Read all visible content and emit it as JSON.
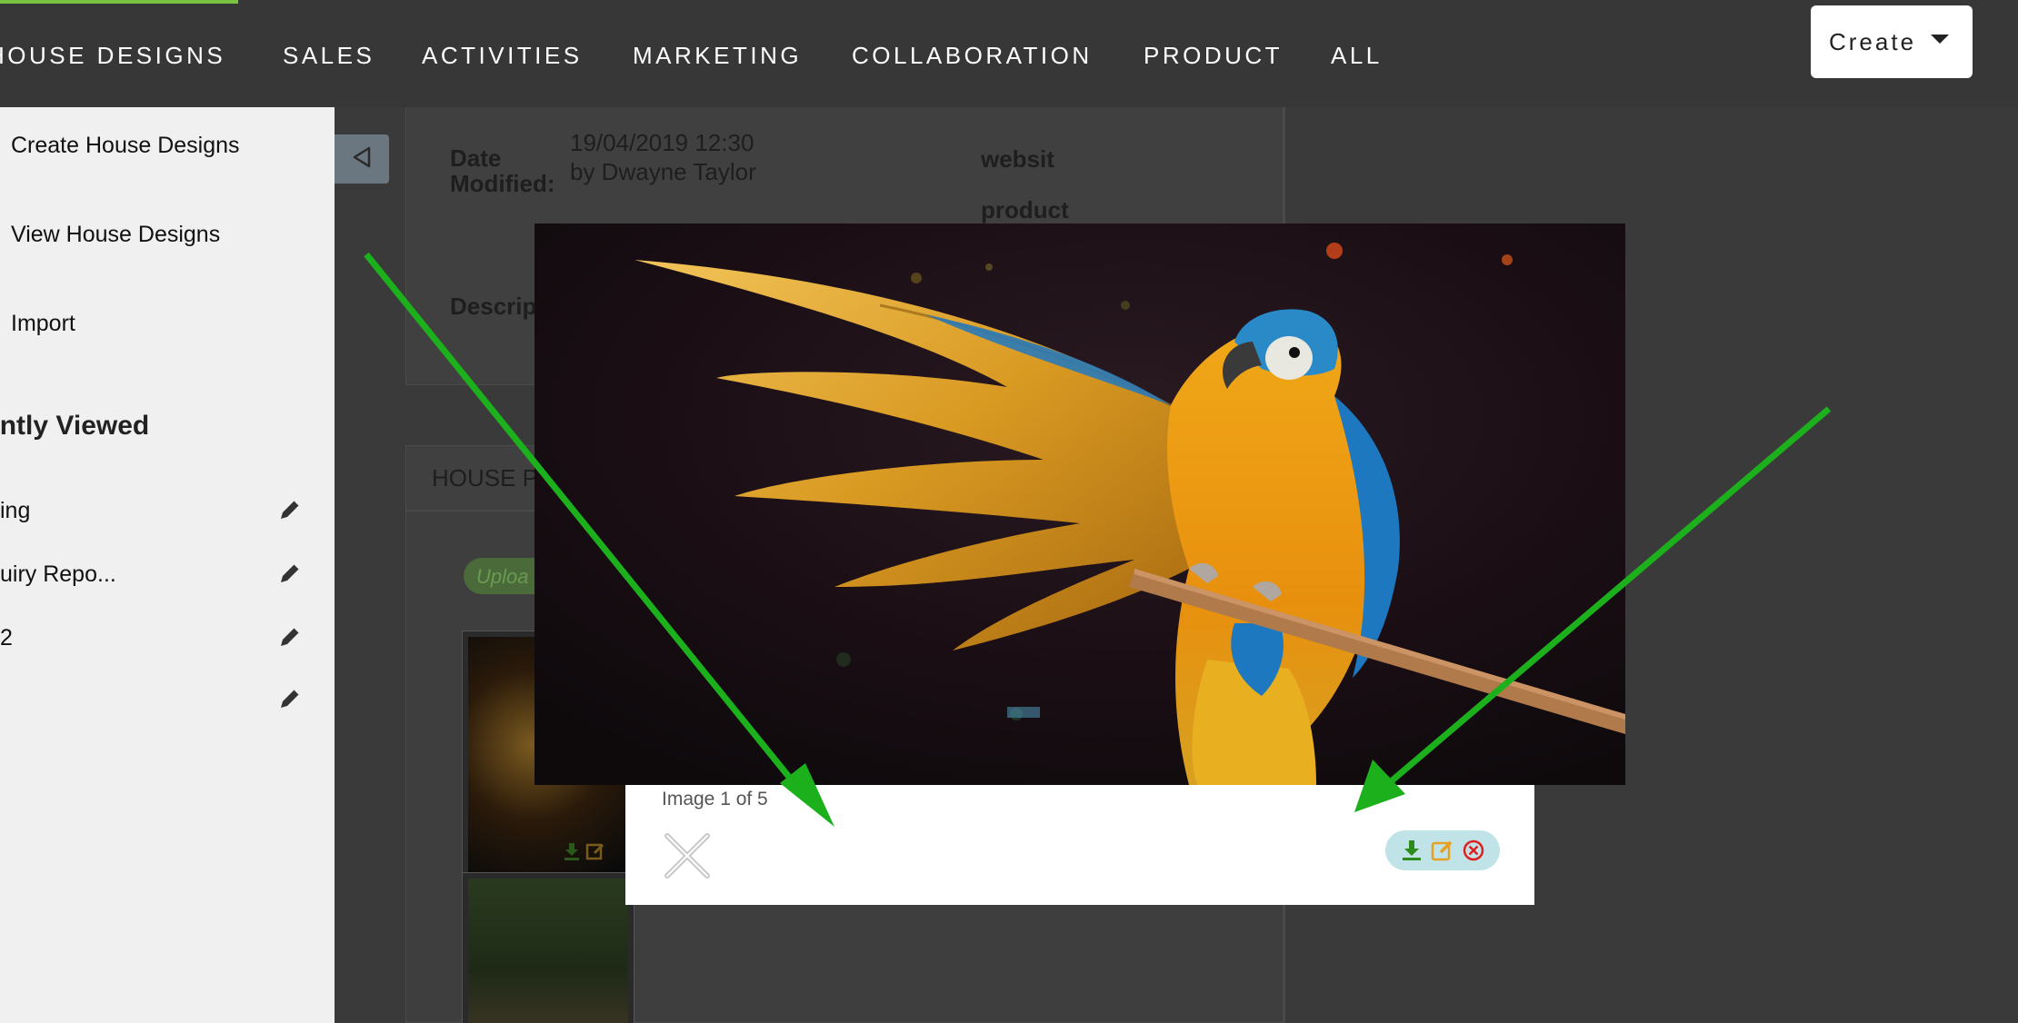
{
  "nav": {
    "items": [
      {
        "label": "HOUSE DESIGNS"
      },
      {
        "label": "SALES"
      },
      {
        "label": "ACTIVITIES"
      },
      {
        "label": "MARKETING"
      },
      {
        "label": "COLLABORATION"
      },
      {
        "label": "PRODUCT"
      },
      {
        "label": "ALL"
      }
    ],
    "create_label": "Create"
  },
  "sidebar": {
    "links": [
      "Create House Designs",
      "View House Designs",
      "Import"
    ],
    "recent_heading": "Recently Viewed",
    "recent_items": [
      "ing",
      "uiry Repo...",
      "2",
      ""
    ]
  },
  "record": {
    "date_modified_label": "Date Modified:",
    "date_modified_value": "19/04/2019 12:30",
    "modified_by": "by Dwayne Taylor",
    "website_label": "websit",
    "product_label": "product",
    "description_label": "Descrip",
    "panel_title": "HOUSE P",
    "upload_label": "Uploa"
  },
  "lightbox": {
    "counter": "Image 1 of 5"
  },
  "colors": {
    "nav_bg": "#373737",
    "nav_accent": "#7cc242",
    "arrow": "#1cb01c",
    "download": "#2a8a1a",
    "edit": "#e8a020",
    "delete": "#e02020",
    "action_pill": "#bfe3e6"
  },
  "icons": {
    "collapse": "triangle-left-icon",
    "edit": "pencil-icon",
    "close": "close-icon",
    "download": "download-icon",
    "edit_image": "edit-icon",
    "delete": "delete-icon"
  }
}
